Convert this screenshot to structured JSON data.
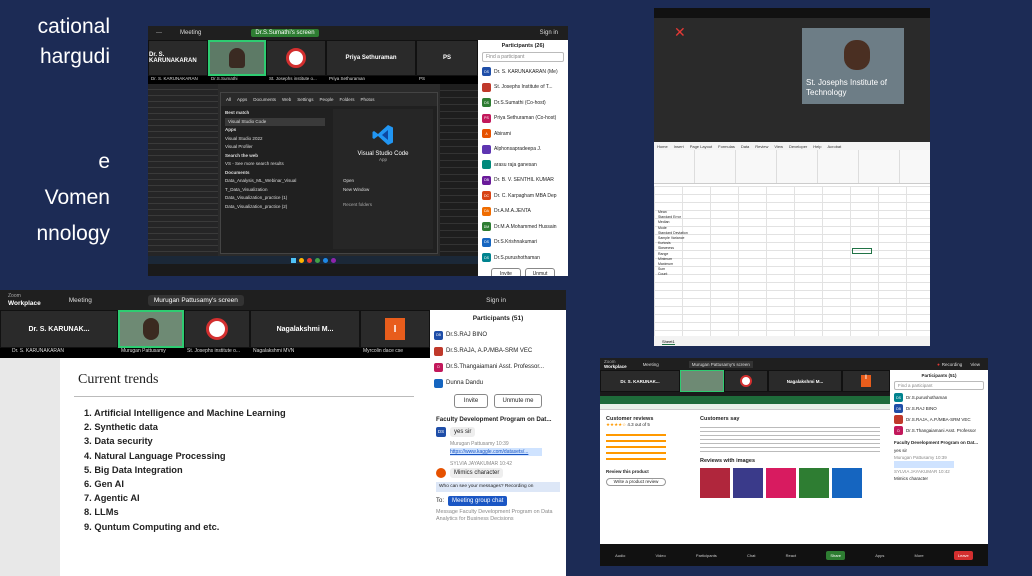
{
  "caption": {
    "lines": [
      "cational",
      "hargudi",
      "e",
      "Vomen",
      "nnology"
    ]
  },
  "shot1": {
    "meeting": "Meeting",
    "share": "Dr.S.Sumathi's screen",
    "signin": "Sign in",
    "tiles": [
      "Dr. S. KARUNAKARAN",
      "Priya Sethuraman",
      "PS"
    ],
    "names": [
      "Dr. S. KARUNAKARAN",
      "Dr.S.Sumathi",
      "St. Josephs institute o...",
      "Priya Sethuraman",
      "PS"
    ],
    "participants_title": "Participants (26)",
    "find": "Find a participant",
    "people": [
      {
        "init": "DS",
        "name": "Dr. S. KARUNAKARAN (Me)",
        "color": "#1f4ea8"
      },
      {
        "init": "",
        "name": "St. Josephs Institute of T...",
        "color": "#c0392b"
      },
      {
        "init": "DS",
        "name": "Dr.S.Sumathi (Co-host)",
        "color": "#2e7d32"
      },
      {
        "init": "PS",
        "name": "Priya Sethuraman (Co-host)",
        "color": "#c2185b"
      },
      {
        "init": "A",
        "name": "Abirami",
        "color": "#e65100"
      },
      {
        "init": "",
        "name": "Alphonsapradeepa J.",
        "color": "#5e35b1"
      },
      {
        "init": "",
        "name": "arasu raja ganesan",
        "color": "#00897b"
      },
      {
        "init": "DB",
        "name": "Dr. B. V. SENTHIL KUMAR",
        "color": "#6a1b9a"
      },
      {
        "init": "DC",
        "name": "Dr. C. Karpagham MBA Dep",
        "color": "#d84315"
      },
      {
        "init": "DA",
        "name": "Dr.A.M.A.JENTA",
        "color": "#ef6c00"
      },
      {
        "init": "DM",
        "name": "Dr.M.A.Mohammed Hussain",
        "color": "#2e7d32"
      },
      {
        "init": "DS",
        "name": "Dr.S.Krishnakumari",
        "color": "#1565c0"
      },
      {
        "init": "DS",
        "name": "Dr.S.purushothaman",
        "color": "#00838f"
      }
    ],
    "invite": "Invite",
    "unmute": "Unmut",
    "vs": {
      "title": "Visual Studio Code",
      "sub": "App",
      "search_tabs": [
        "All",
        "Apps",
        "Documents",
        "Web",
        "Settings",
        "People",
        "Folders",
        "Photos"
      ],
      "best": "Best match",
      "best_item": "Visual Studio Code",
      "apps": "Apps",
      "apps_items": [
        "Visual Studio 2022",
        "Visual Profiler"
      ],
      "web": "Search the web",
      "web_item": "VS - See more search results",
      "docs": "Documents",
      "doc_items": [
        "Data_Analysis_ML_Webinar_Visual",
        "T_Data_Visualization",
        "Data_Visualization_practice (1)",
        "Data_Visualization_practice (2)"
      ],
      "open": "Open",
      "newwin": "New Window",
      "recent": "Recent folders"
    }
  },
  "shot2": {
    "caption": "St. Josephs Institute of Technology",
    "menu": [
      "Home",
      "Insert",
      "Page Layout",
      "Formulas",
      "Data",
      "Review",
      "View",
      "Developer",
      "Help",
      "Acrobat"
    ],
    "search": "Search",
    "sheet": "Sheet1",
    "stats": [
      "Mean",
      "Standard Error",
      "Median",
      "Mode",
      "Standard Deviation",
      "Sample Variance",
      "Kurtosis",
      "Skewness",
      "Range",
      "Minimum",
      "Maximum",
      "Sum",
      "Count"
    ]
  },
  "shot3": {
    "brand": "Workplace",
    "brand_top": "Zoom",
    "meeting": "Meeting",
    "share": "Murugan Pattusamy's screen",
    "signin": "Sign in",
    "tiles": [
      "Dr. S. KARUNAK...",
      "Nagalakshmi M...",
      "I"
    ],
    "names": [
      "Dr. S. KARUNAKARAN",
      "Murugan Pattusamy",
      "St. Josephs institute o...",
      "Nagalakshmi MVN",
      "Myrcolin dace cse"
    ],
    "slide_title": "Current trends",
    "trends": [
      "1. Artificial Intelligence and Machine Learning",
      "2. Synthetic data",
      "3. Data security",
      "4. Natural Language Processing",
      "5. Big Data Integration",
      "6. Gen AI",
      "7. Agentic AI",
      "8. LLMs",
      "9. Quntum Computing  and etc."
    ],
    "participants_title": "Participants (51)",
    "people": [
      {
        "init": "DB",
        "name": "Dr.S.RAJ BINO",
        "color": "#1f4ea8"
      },
      {
        "init": "",
        "name": "Dr.S.RAJA, A.P./MBA-SRM VEC",
        "color": "#c0392b"
      },
      {
        "init": "D",
        "name": "Dr.S.Thangaiamani Asst. Professor...",
        "color": "#c2185b"
      },
      {
        "init": "",
        "name": "Dunna Dandu",
        "color": "#1565c0"
      }
    ],
    "invite": "Invite",
    "unmute": "Unmute me",
    "chat_title": "Faculty Development Program on Dat...",
    "msgs": [
      {
        "who": "DS",
        "text": "yes sir"
      },
      {
        "who": "Murugan Pattusamy 10:39",
        "text": "https://www.kaggle.com/datasets/..."
      },
      {
        "who": "SYLVIA JAYAKUMAR 10:42",
        "text": "Mimics character"
      }
    ],
    "who_see": "Who can see your messages? Recording on",
    "to": "To:",
    "to_val": "Meeting group chat",
    "input": "Message Faculty Development Program on Data Analytics for Business Decisions"
  },
  "shot4": {
    "brand": "Workplace",
    "brand_top": "Zoom",
    "meeting": "Meeting",
    "share": "Murugan Pattusamy's screen",
    "rec": "Recording",
    "view": "View",
    "tiles": [
      "Dr. S. KARUNAK...",
      "Nagalakshmi M...",
      "I"
    ],
    "names": [
      "Dr. S. KARUNAKARAN",
      "Murugan Pattusamy",
      "St. Josephs institute o...",
      "Nagalakshmi MVN",
      "Myrcolin dace cse"
    ],
    "participants_title": "Participants (51)",
    "find": "Find a participant",
    "people": [
      {
        "init": "DS",
        "name": "Dr.S.purushothaman",
        "color": "#00838f"
      },
      {
        "init": "DB",
        "name": "Dr.S.RAJ BINO",
        "color": "#1f4ea8"
      },
      {
        "init": "",
        "name": "Dr.S.RAJA, A.P./MBA-SRM VEC",
        "color": "#c0392b"
      },
      {
        "init": "D",
        "name": "Dr.S.Thangaiamani Asst. Professor",
        "color": "#c2185b"
      }
    ],
    "chat_title": "Faculty Development Program on Dat...",
    "msgs": [
      "yes sir",
      "Murugan Pattusamy 10:39",
      "SYLVIA JAYAKUMAR 10:42",
      "Mimics character"
    ],
    "reviews": "Customer reviews",
    "rating": "4.3 out of 5",
    "says": "Customers say",
    "with_images": "Reviews with images",
    "review_product": "Review this product",
    "write": "Write a product review",
    "toolbar": [
      "Audio",
      "Video",
      "Participants",
      "Chat",
      "React",
      "Share",
      "Apps",
      "More",
      "Leave"
    ]
  }
}
